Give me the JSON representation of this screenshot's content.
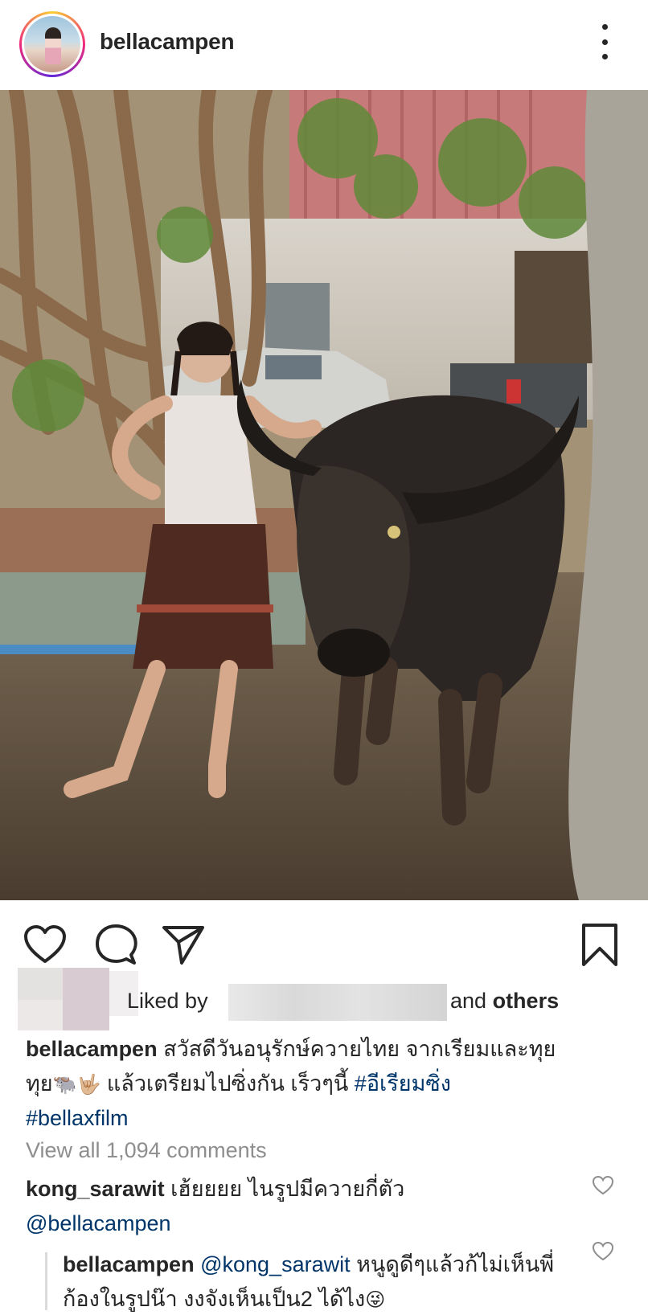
{
  "post": {
    "username": "bellacampen",
    "more_icon": "more-vertical-icon"
  },
  "actions": {
    "like_icon": "heart-icon",
    "comment_icon": "comment-icon",
    "share_icon": "paper-plane-icon",
    "save_icon": "bookmark-icon"
  },
  "likes": {
    "liked_by_label": "Liked by",
    "and_label": "and",
    "others_label": "others"
  },
  "caption": {
    "username": "bellacampen",
    "text_line1": "สวัสดีวันอนุรักษ์ควายไทย จากเรียมและทุย",
    "text_line2a": "ทุย",
    "emoji1": "🐃",
    "emoji2": "🤟🏼",
    "text_line2b": " แล้วเตรียมไปซิ่งกัน เร็วๆนี้ ",
    "hashtag1": "#อีเรียมซิ่ง",
    "hashtag2": "#bellaxfilm"
  },
  "view_all_comments": "View all 1,094 comments",
  "comments": [
    {
      "username": "kong_sarawit",
      "text": "เฮ้ยยยย ไนรูปมีควายกี่ตัว",
      "mention": "@bellacampen"
    },
    {
      "username": "bellacampen",
      "mention": "@kong_sarawit",
      "text": "หนูดูดีๆแล้วก้ไม่เห็นพี่ก้องในรูปน๊า งงจังเห็นเป็น2 ได้ไง",
      "emoji": "😜"
    }
  ],
  "colors": {
    "text": "#262626",
    "secondary": "#8e8e8e",
    "link": "#003569"
  }
}
